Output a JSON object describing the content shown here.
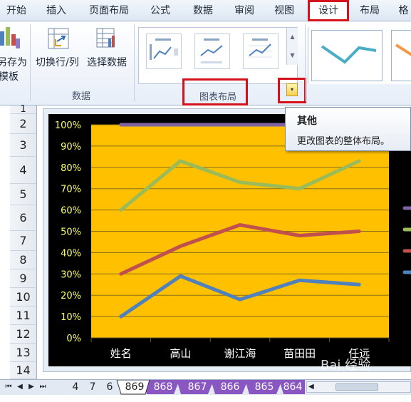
{
  "ribbon": {
    "tabs": [
      {
        "label": "开始"
      },
      {
        "label": "插入"
      },
      {
        "label": "页面布局"
      },
      {
        "label": "公式"
      },
      {
        "label": "数据"
      },
      {
        "label": "审阅"
      },
      {
        "label": "视图"
      },
      {
        "label": "设计"
      },
      {
        "label": "布局"
      },
      {
        "label": "格"
      }
    ],
    "save_template": {
      "line1": "另存为",
      "line2": "模板"
    },
    "switch_row_col": "切换行/列",
    "select_data": "选择数据",
    "group_data": "数据",
    "group_chart_layout": "图表布局"
  },
  "tooltip": {
    "title": "其他",
    "body": "更改图表的整体布局。"
  },
  "rows": [
    "1",
    "2",
    "3",
    "4",
    "5",
    "6",
    "7",
    "8",
    "9",
    "10",
    "11",
    "12",
    "13",
    "14"
  ],
  "sheet_tabs": [
    {
      "label": "4"
    },
    {
      "label": "7"
    },
    {
      "label": "6"
    },
    {
      "label": "869"
    },
    {
      "label": "868"
    },
    {
      "label": "867"
    },
    {
      "label": "866"
    },
    {
      "label": "865"
    },
    {
      "label": "864"
    }
  ],
  "watermark": "Bai 经验",
  "colors": {
    "plot_bg": "#ffc000",
    "chart_bg": "#000000",
    "axis_text": "#ffff66",
    "category_text": "#ffffff",
    "accent_red": "#d5121b",
    "series_green": "#9bbb59",
    "series_red": "#c0504d",
    "series_blue": "#4f81bd",
    "series_purple": "#8064a2",
    "sheet_tab_purple": "#8a56c2"
  },
  "chart_data": {
    "type": "line",
    "categories": [
      "姓名",
      "高山",
      "谢江海",
      "苗田田",
      "任远"
    ],
    "y_tick_labels": [
      "0%",
      "10%",
      "20%",
      "30%",
      "40%",
      "50%",
      "60%",
      "70%",
      "80%",
      "90%",
      "100%"
    ],
    "ylim": [
      0,
      1
    ],
    "grid": true,
    "legend": "right",
    "series": [
      {
        "values": [
          1.0,
          1.0,
          1.0,
          1.0,
          1.0
        ],
        "color": "#8064a2"
      },
      {
        "values": [
          0.6,
          0.83,
          0.73,
          0.7,
          0.83
        ],
        "color": "#9bbb59"
      },
      {
        "values": [
          0.3,
          0.43,
          0.53,
          0.48,
          0.5
        ],
        "color": "#c0504d"
      },
      {
        "values": [
          0.1,
          0.29,
          0.18,
          0.27,
          0.25
        ],
        "color": "#4f81bd"
      }
    ]
  }
}
